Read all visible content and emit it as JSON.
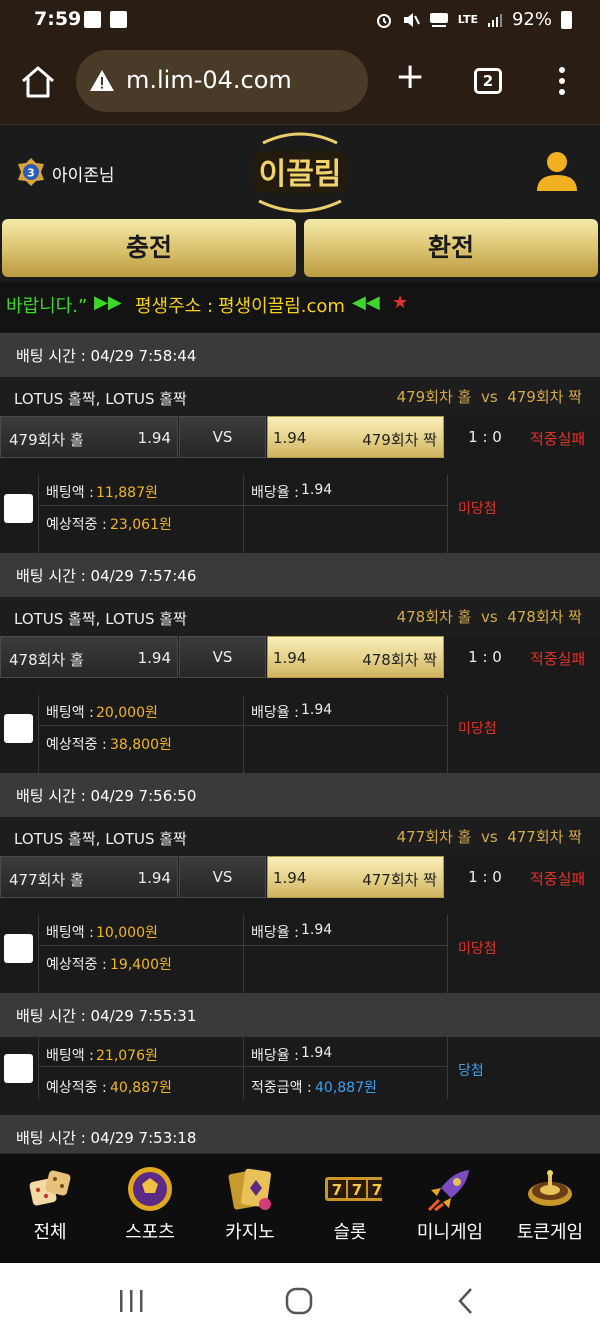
{
  "status_bar": {
    "time": "7:59",
    "network": "LTE",
    "battery": "92%",
    "icons": [
      "gallery-icon",
      "check-icon",
      "alarm-icon",
      "mute-icon",
      "hd-voice-icon",
      "signal-icon",
      "battery-icon"
    ]
  },
  "browser": {
    "url": "m.lim-04.com",
    "tab_count": "2",
    "icons": [
      "home-icon",
      "warning-icon",
      "plus-icon",
      "tabs-icon",
      "more-vert-icon"
    ]
  },
  "header": {
    "username": "아이존님",
    "rank": "3",
    "logo_text": "이끌림",
    "charge_label": "충전",
    "exchange_label": "환전"
  },
  "marquee": {
    "text_1": "바랍니다.”",
    "arrows_right": "▶▶",
    "address_label": "평생주소 :",
    "address": "평생이끌림.com",
    "arrows_left": "◀◀",
    "star": "★"
  },
  "bets": [
    {
      "time_label": "배팅 시간 : 04/29 7:58:44",
      "game": "LOTUS 홀짝, LOTUS 홀짝",
      "match_home": "479회차 홀",
      "vs_word": "vs",
      "match_away": "479회차 짝",
      "home_label": "479회차 홀",
      "home_odds": "1.94",
      "vs": "VS",
      "away_odds": "1.94",
      "away_label": "479회차 짝",
      "score": "1 : 0",
      "result": "적중실패",
      "bet_amount_label": "배팅액 :",
      "bet_amount": "11,887원",
      "odds_label": "배당율 :",
      "odds": "1.94",
      "expected_label": "예상적중 :",
      "expected": "23,061원",
      "status": "미당첨"
    },
    {
      "time_label": "배팅 시간 : 04/29 7:57:46",
      "game": "LOTUS 홀짝, LOTUS 홀짝",
      "match_home": "478회차 홀",
      "vs_word": "vs",
      "match_away": "478회차 짝",
      "home_label": "478회차 홀",
      "home_odds": "1.94",
      "vs": "VS",
      "away_odds": "1.94",
      "away_label": "478회차 짝",
      "score": "1 : 0",
      "result": "적중실패",
      "bet_amount_label": "배팅액 :",
      "bet_amount": "20,000원",
      "odds_label": "배당율 :",
      "odds": "1.94",
      "expected_label": "예상적중 :",
      "expected": "38,800원",
      "status": "미당첨"
    },
    {
      "time_label": "배팅 시간 : 04/29 7:56:50",
      "game": "LOTUS 홀짝, LOTUS 홀짝",
      "match_home": "477회차 홀",
      "vs_word": "vs",
      "match_away": "477회차 짝",
      "home_label": "477회차 홀",
      "home_odds": "1.94",
      "vs": "VS",
      "away_odds": "1.94",
      "away_label": "477회차 짝",
      "score": "1 : 0",
      "result": "적중실패",
      "bet_amount_label": "배팅액 :",
      "bet_amount": "10,000원",
      "odds_label": "배당율 :",
      "odds": "1.94",
      "expected_label": "예상적중 :",
      "expected": "19,400원",
      "status": "미당첨"
    },
    {
      "time_label": "배팅 시간 : 04/29 7:55:31",
      "bet_amount_label": "배팅액 :",
      "bet_amount": "21,076원",
      "odds_label": "배당율 :",
      "odds": "1.94",
      "expected_label": "예상적중 :",
      "expected": "40,887원",
      "win_amount_label": "적중금액 :",
      "win_amount": "40,887원",
      "status": "당첨"
    },
    {
      "time_label": "배팅 시간 : 04/29 7:53:18"
    }
  ],
  "bottom_nav": [
    {
      "label": "전체",
      "icon": "dice-icon"
    },
    {
      "label": "스포츠",
      "icon": "soccer-ball-icon"
    },
    {
      "label": "카지노",
      "icon": "cards-icon"
    },
    {
      "label": "슬롯",
      "icon": "slot-777-icon"
    },
    {
      "label": "미니게임",
      "icon": "rocket-icon"
    },
    {
      "label": "토큰게임",
      "icon": "roulette-icon"
    }
  ],
  "system_nav": [
    "recents-icon",
    "home-circle-icon",
    "back-icon"
  ],
  "colors": {
    "gold": "#d9c06b",
    "fail_red": "#e0322a",
    "win_blue": "#3aa0f0",
    "amount_gold": "#f0b624",
    "marquee_green": "#3fd62a",
    "marquee_yellow": "#f5d21a"
  }
}
